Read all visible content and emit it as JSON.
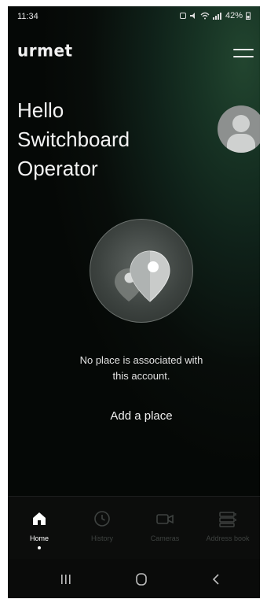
{
  "status_bar": {
    "time": "11:34",
    "battery": "42%"
  },
  "header": {
    "logo": "urmet"
  },
  "greeting": {
    "line1": "Hello",
    "line2": "Switchboard",
    "line3": "Operator"
  },
  "main": {
    "empty_message_line1": "No place is associated with",
    "empty_message_line2": "this account.",
    "add_place_label": "Add a place"
  },
  "tabs": [
    {
      "label": "Home",
      "icon": "home-icon",
      "active": true
    },
    {
      "label": "History",
      "icon": "clock-icon",
      "active": false
    },
    {
      "label": "Cameras",
      "icon": "camera-icon",
      "active": false
    },
    {
      "label": "Address book",
      "icon": "address-book-icon",
      "active": false
    }
  ],
  "colors": {
    "background_accent": "#22452f",
    "active_tab": "#ffffff",
    "inactive_tab": "#3e4240"
  }
}
